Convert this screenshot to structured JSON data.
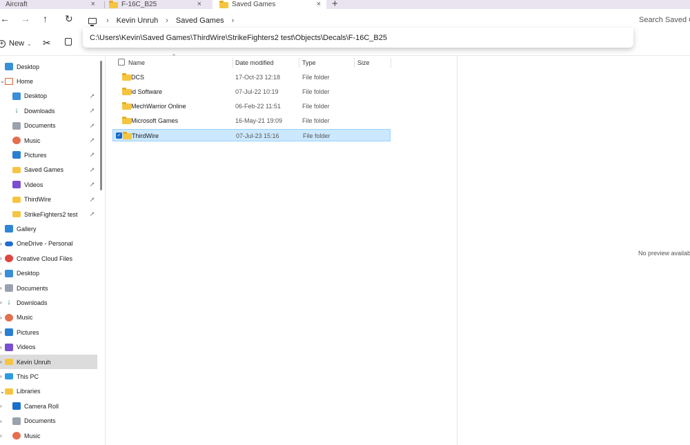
{
  "tabs": [
    {
      "label": "Aircraft",
      "active": false
    },
    {
      "label": "F-16C_B25",
      "active": false
    },
    {
      "label": "Saved Games",
      "active": true
    }
  ],
  "tab_close_glyph": "×",
  "new_tab_glyph": "+",
  "breadcrumb": [
    "Kevin Unruh",
    "Saved Games"
  ],
  "breadcrumb_sep": "›",
  "address_path": "C:\\Users\\Kevin\\Saved Games\\ThirdWire\\StrikeFighters2 test\\Objects\\Decals\\F-16C_B25",
  "search_placeholder": "Search Saved Ga",
  "command_bar": {
    "new_label": "New",
    "new_chevron": "⌄"
  },
  "sidebar": [
    {
      "label": "Desktop",
      "icon": "desktop-icon",
      "chevron": "",
      "pinned": false
    },
    {
      "label": "Home",
      "icon": "home-icon",
      "chevron": "⌄",
      "pinned": false
    },
    {
      "label": "Desktop",
      "icon": "desktop-icon",
      "chevron": "",
      "pinned": true
    },
    {
      "label": "Downloads",
      "icon": "download-icon",
      "chevron": "",
      "pinned": true
    },
    {
      "label": "Documents",
      "icon": "documents-icon",
      "chevron": "",
      "pinned": true
    },
    {
      "label": "Music",
      "icon": "music-icon",
      "chevron": "",
      "pinned": true
    },
    {
      "label": "Pictures",
      "icon": "pictures-icon",
      "chevron": "",
      "pinned": true
    },
    {
      "label": "Saved Games",
      "icon": "folder-icon",
      "chevron": "",
      "pinned": true
    },
    {
      "label": "Videos",
      "icon": "videos-icon",
      "chevron": "",
      "pinned": true
    },
    {
      "label": "ThirdWire",
      "icon": "folder-icon",
      "chevron": "",
      "pinned": true
    },
    {
      "label": "StrikeFighters2 test",
      "icon": "folder-icon",
      "chevron": "",
      "pinned": true
    },
    {
      "label": "Gallery",
      "icon": "gallery-icon",
      "chevron": "",
      "pinned": false
    },
    {
      "label": "OneDrive - Personal",
      "icon": "cloud-icon",
      "chevron": "›",
      "pinned": false
    },
    {
      "label": "Creative Cloud Files",
      "icon": "creative-cloud-icon",
      "chevron": "›",
      "pinned": false
    },
    {
      "label": "Desktop",
      "icon": "desktop-icon",
      "chevron": "›",
      "pinned": false
    },
    {
      "label": "Documents",
      "icon": "documents-icon",
      "chevron": "›",
      "pinned": false
    },
    {
      "label": "Downloads",
      "icon": "download-icon",
      "chevron": "›",
      "pinned": false
    },
    {
      "label": "Music",
      "icon": "music-icon",
      "chevron": "›",
      "pinned": false
    },
    {
      "label": "Pictures",
      "icon": "pictures-icon",
      "chevron": "›",
      "pinned": false
    },
    {
      "label": "Videos",
      "icon": "videos-icon",
      "chevron": "›",
      "pinned": false
    },
    {
      "label": "Kevin Unruh",
      "icon": "folder-icon",
      "chevron": "›",
      "pinned": false,
      "selected": true
    },
    {
      "label": "This PC",
      "icon": "pc-icon",
      "chevron": "›",
      "pinned": false
    },
    {
      "label": "Libraries",
      "icon": "folder-icon",
      "chevron": "⌄",
      "pinned": false
    },
    {
      "label": "Camera Roll",
      "icon": "camera-roll-icon",
      "chevron": "›",
      "pinned": false
    },
    {
      "label": "Documents",
      "icon": "documents-icon",
      "chevron": "›",
      "pinned": false
    },
    {
      "label": "Music",
      "icon": "music-icon",
      "chevron": "›",
      "pinned": false
    }
  ],
  "pin_glyph": "📌",
  "columns": [
    "Name",
    "Date modified",
    "Type",
    "Size"
  ],
  "files": [
    {
      "name": "DCS",
      "date": "17-Oct-23 12:18",
      "type": "File folder",
      "selected": false
    },
    {
      "name": "id Software",
      "date": "07-Jul-22 10:19",
      "type": "File folder",
      "selected": false
    },
    {
      "name": "MechWarrior Online",
      "date": "06-Feb-22 11:51",
      "type": "File folder",
      "selected": false
    },
    {
      "name": "Microsoft Games",
      "date": "16-May-21 19:09",
      "type": "File folder",
      "selected": false
    },
    {
      "name": "ThirdWire",
      "date": "07-Jul-23 15:16",
      "type": "File folder",
      "selected": true
    }
  ],
  "check_glyph": "✓",
  "preview_text": "No preview available."
}
